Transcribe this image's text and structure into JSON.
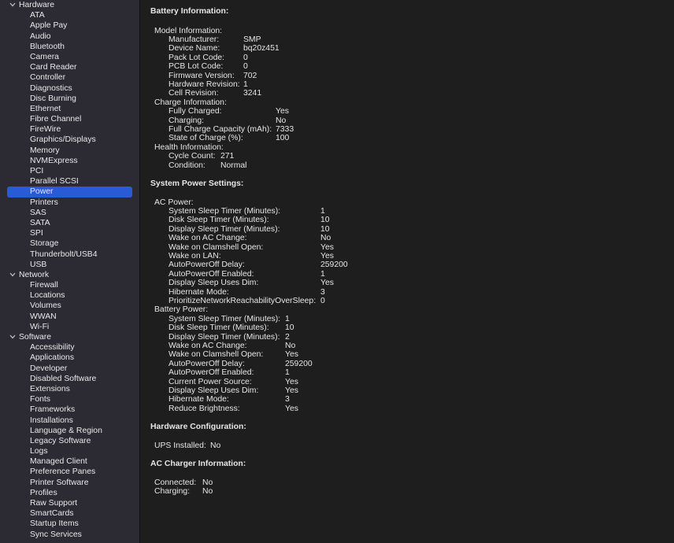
{
  "sidebar": {
    "selected": "Power",
    "groups": [
      {
        "label": "Hardware",
        "items": [
          "ATA",
          "Apple Pay",
          "Audio",
          "Bluetooth",
          "Camera",
          "Card Reader",
          "Controller",
          "Diagnostics",
          "Disc Burning",
          "Ethernet",
          "Fibre Channel",
          "FireWire",
          "Graphics/Displays",
          "Memory",
          "NVMExpress",
          "PCI",
          "Parallel SCSI",
          "Power",
          "Printers",
          "SAS",
          "SATA",
          "SPI",
          "Storage",
          "Thunderbolt/USB4",
          "USB"
        ]
      },
      {
        "label": "Network",
        "items": [
          "Firewall",
          "Locations",
          "Volumes",
          "WWAN",
          "Wi-Fi"
        ]
      },
      {
        "label": "Software",
        "items": [
          "Accessibility",
          "Applications",
          "Developer",
          "Disabled Software",
          "Extensions",
          "Fonts",
          "Frameworks",
          "Installations",
          "Language & Region",
          "Legacy Software",
          "Logs",
          "Managed Client",
          "Preference Panes",
          "Printer Software",
          "Profiles",
          "Raw Support",
          "SmartCards",
          "Startup Items",
          "Sync Services"
        ]
      }
    ]
  },
  "icons": {
    "disclosure": "chevron-down-icon"
  },
  "colors": {
    "selection": "#2a5bd7",
    "sidebar_bg": "#2c2b33",
    "content_bg": "#1e1e1e"
  },
  "content": {
    "sections": [
      {
        "heading": "Battery Information:",
        "blocks": [
          {
            "title": "Model Information:",
            "rows": [
              [
                "Manufacturer:",
                "SMP"
              ],
              [
                "Device Name:",
                "bq20z451"
              ],
              [
                "Pack Lot Code:",
                "0"
              ],
              [
                "PCB Lot Code:",
                "0"
              ],
              [
                "Firmware Version:",
                "702"
              ],
              [
                "Hardware Revision:",
                "1"
              ],
              [
                "Cell Revision:",
                "3241"
              ]
            ]
          },
          {
            "title": "Charge Information:",
            "rows": [
              [
                "Fully Charged:",
                "Yes"
              ],
              [
                "Charging:",
                "No"
              ],
              [
                "Full Charge Capacity (mAh):",
                "7333"
              ],
              [
                "State of Charge (%):",
                "100"
              ]
            ]
          },
          {
            "title": "Health Information:",
            "rows": [
              [
                "Cycle Count:",
                "271"
              ],
              [
                "Condition:",
                "Normal"
              ]
            ]
          }
        ]
      },
      {
        "heading": "System Power Settings:",
        "blocks": [
          {
            "title": "AC Power:",
            "rows": [
              [
                "System Sleep Timer (Minutes):",
                "1"
              ],
              [
                "Disk Sleep Timer (Minutes):",
                "10"
              ],
              [
                "Display Sleep Timer (Minutes):",
                "10"
              ],
              [
                "Wake on AC Change:",
                "No"
              ],
              [
                "Wake on Clamshell Open:",
                "Yes"
              ],
              [
                "Wake on LAN:",
                "Yes"
              ],
              [
                "AutoPowerOff Delay:",
                "259200"
              ],
              [
                "AutoPowerOff Enabled:",
                "1"
              ],
              [
                "Display Sleep Uses Dim:",
                "Yes"
              ],
              [
                "Hibernate Mode:",
                "3"
              ],
              [
                "PrioritizeNetworkReachabilityOverSleep:",
                "0"
              ]
            ]
          },
          {
            "title": "Battery Power:",
            "rows": [
              [
                "System Sleep Timer (Minutes):",
                "1"
              ],
              [
                "Disk Sleep Timer (Minutes):",
                "10"
              ],
              [
                "Display Sleep Timer (Minutes):",
                "2"
              ],
              [
                "Wake on AC Change:",
                "No"
              ],
              [
                "Wake on Clamshell Open:",
                "Yes"
              ],
              [
                "AutoPowerOff Delay:",
                "259200"
              ],
              [
                "AutoPowerOff Enabled:",
                "1"
              ],
              [
                "Current Power Source:",
                "Yes"
              ],
              [
                "Display Sleep Uses Dim:",
                "Yes"
              ],
              [
                "Hibernate Mode:",
                "3"
              ],
              [
                "Reduce Brightness:",
                "Yes"
              ]
            ]
          }
        ]
      },
      {
        "heading": "Hardware Configuration:",
        "blocks": [
          {
            "title": "",
            "rows": [
              [
                "UPS Installed:",
                "No"
              ]
            ]
          }
        ]
      },
      {
        "heading": "AC Charger Information:",
        "blocks": [
          {
            "title": "",
            "rows": [
              [
                "Connected:",
                "No"
              ],
              [
                "Charging:",
                "No"
              ]
            ]
          }
        ]
      }
    ]
  }
}
